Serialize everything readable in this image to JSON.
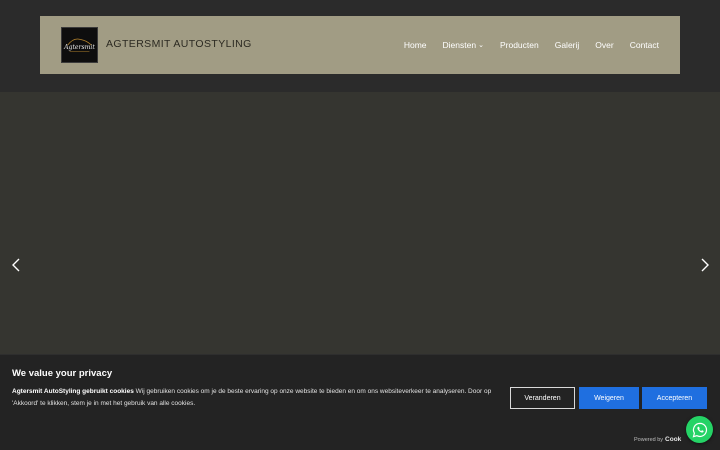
{
  "header": {
    "brand": "AGTERSMIT AUTOSTYLING",
    "logo_script": "Agtersmit",
    "bg_color": "#a19c84"
  },
  "nav": {
    "items": [
      {
        "label": "Home",
        "has_dropdown": false
      },
      {
        "label": "Diensten",
        "has_dropdown": true
      },
      {
        "label": "Producten",
        "has_dropdown": false
      },
      {
        "label": "Galerij",
        "has_dropdown": false
      },
      {
        "label": "Over",
        "has_dropdown": false
      },
      {
        "label": "Contact",
        "has_dropdown": false
      }
    ],
    "dropdown_icon": "chevron-down-icon"
  },
  "slider": {
    "prev_icon": "chevron-left-icon",
    "next_icon": "chevron-right-icon"
  },
  "cookie": {
    "title": "We value your privacy",
    "lead": "Agtersmit AutoStyling gebruikt cookies",
    "text": " Wij gebruiken cookies om je de beste ervaring op onze website te bieden en om ons websiteverkeer te analyseren. Door op 'Akkoord' te klikken, stem je in met het gebruik van alle cookies.",
    "buttons": {
      "change": "Veranderen",
      "reject": "Weigeren",
      "accept": "Accepteren"
    },
    "powered_by": "Powered by",
    "powered_brand": "Cook",
    "accent_color": "#1f6fe0"
  },
  "whatsapp": {
    "icon": "whatsapp-icon",
    "color": "#25d366"
  }
}
